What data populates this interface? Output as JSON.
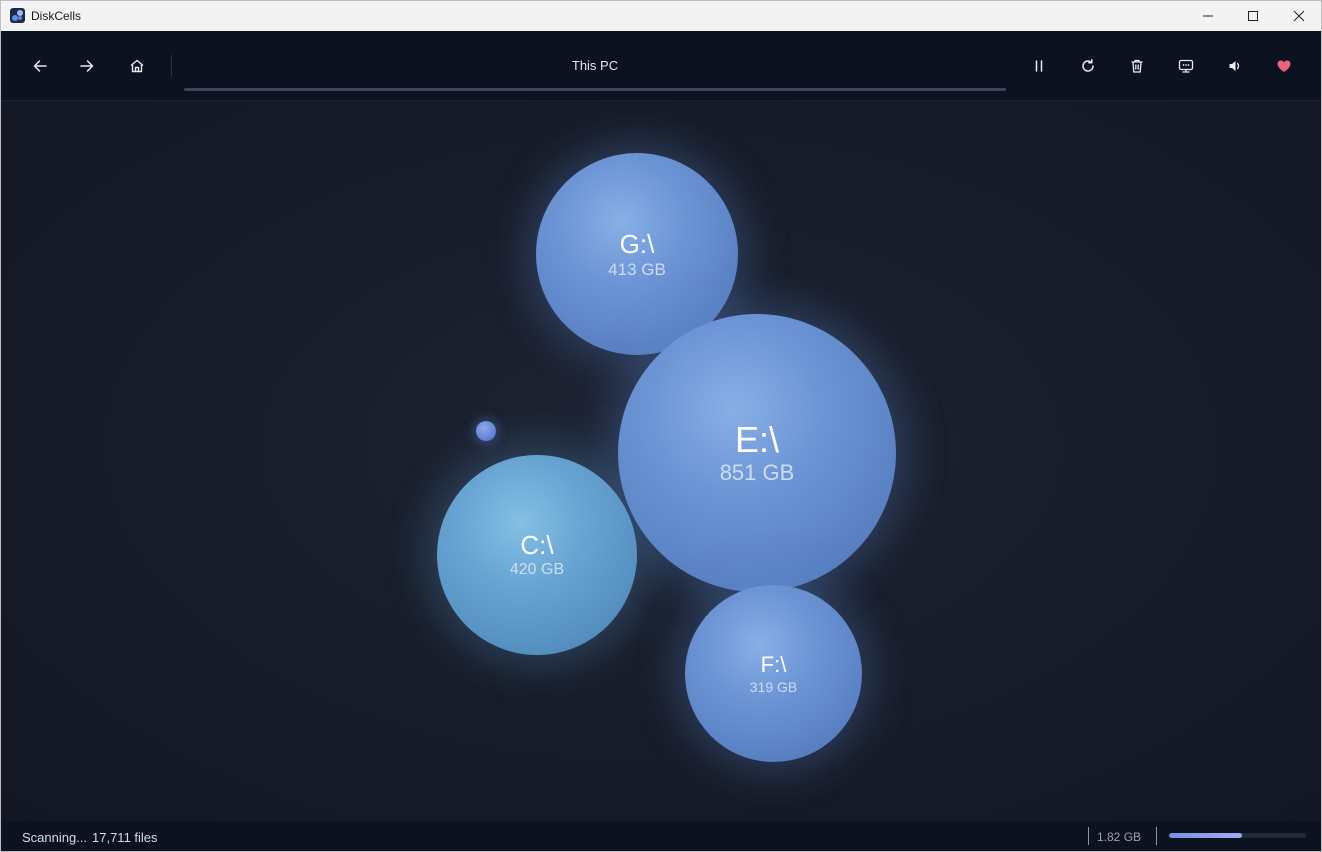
{
  "window": {
    "title": "DiskCells"
  },
  "toolbar": {
    "location": "This PC",
    "location_progress": 1.0,
    "buttons": [
      "back-arrow-icon",
      "forward-arrow-icon",
      "home-icon",
      "pause-icon",
      "refresh-icon",
      "trash-icon",
      "display-icon",
      "volume-icon",
      "heart-icon"
    ]
  },
  "drives": [
    {
      "name": "G:\\",
      "size": "413 GB"
    },
    {
      "name": "E:\\",
      "size": "851 GB"
    },
    {
      "name": "C:\\",
      "size": "420 GB"
    },
    {
      "name": "F:\\",
      "size": "319 GB"
    }
  ],
  "status": {
    "state": "Scanning...",
    "files": "17,711 files",
    "size": "1.82 GB",
    "scan_progress": 0.53
  },
  "colors": {
    "accent_heart": "#f0617a",
    "bubble_blue": "#6d95d6",
    "bubble_cyan": "#67a3d2",
    "progress": "#8f9cee"
  }
}
